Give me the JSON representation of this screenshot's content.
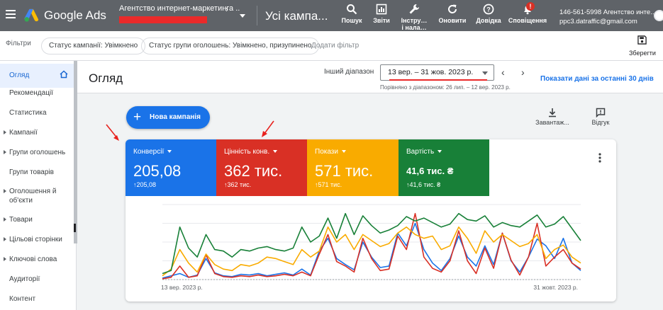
{
  "header": {
    "product": "Google Ads",
    "account_name": "Агентство интернет-маркетинга ...",
    "page_title": "Усі кампа...",
    "tools": [
      {
        "label": "Пошук"
      },
      {
        "label": "Звіти"
      },
      {
        "label": "Інстру…",
        "label2": "і нала…"
      },
      {
        "label": "Оновити"
      },
      {
        "label": "Довідка"
      },
      {
        "label": "Сповіщення",
        "badge": "!"
      }
    ],
    "account_id": "146-561-5998 Агентство инте...",
    "account_email": "ppc3.datraffic@gmail.com"
  },
  "filters": {
    "label": "Фільтри",
    "chips": [
      "Статус кампанії: Увімкнено",
      "Статус групи оголошень: Увімкнено, призупинено"
    ],
    "add_filter": "Додати фільтр",
    "save": "Зберегти"
  },
  "sidebar": {
    "items": [
      {
        "label": "Огляд"
      },
      {
        "label": "Рекомендації"
      },
      {
        "label": "Статистика"
      },
      {
        "label": "Кампанії"
      },
      {
        "label": "Групи оголошень"
      },
      {
        "label": "Групи товарів"
      },
      {
        "label": "Оголошення й",
        "label2": "об'єкти"
      },
      {
        "label": "Товари"
      },
      {
        "label": "Цільові сторінки"
      },
      {
        "label": "Ключові слова"
      },
      {
        "label": "Аудиторії"
      },
      {
        "label": "Контент"
      }
    ]
  },
  "main": {
    "title": "Огляд",
    "range_label": "Інший діапазон",
    "date_range": "13 вер. – 31 жов. 2023 р.",
    "compare_text": "Порівняно з діапазоном: 26 лип. – 12 вер. 2023 р.",
    "show_last_30": "Показати дані за останні 30 днів",
    "new_campaign": "Нова кампанія",
    "download": "Завантаж...",
    "feedback": "Відгук"
  },
  "metrics": [
    {
      "name": "Конверсії",
      "value": "205,08",
      "delta": "↑205,08",
      "color": "#1a73e8"
    },
    {
      "name": "Цінність конв.",
      "value": "362 тис.",
      "delta": "↑362 тис.",
      "color": "#d93025"
    },
    {
      "name": "Покази",
      "value": "571 тис.",
      "delta": "↑571 тис.",
      "color": "#f9ab00"
    },
    {
      "name": "Вартість",
      "value": "41,6 тис. ₴",
      "delta": "↑41,6 тис. ₴",
      "color": "#188038"
    }
  ],
  "chart_data": {
    "type": "line",
    "x_start": "13 вер. 2023 р.",
    "x_end": "31 жовт. 2023 р.",
    "x_count": 49,
    "ylim": [
      0,
      100
    ],
    "grid": true,
    "series": [
      {
        "name": "Конверсії",
        "color": "#1a73e8",
        "values": [
          2,
          5,
          8,
          3,
          6,
          28,
          9,
          5,
          4,
          7,
          6,
          8,
          5,
          7,
          9,
          6,
          14,
          6,
          38,
          55,
          28,
          20,
          13,
          50,
          30,
          16,
          18,
          62,
          45,
          75,
          40,
          22,
          12,
          28,
          58,
          30,
          18,
          45,
          20,
          62,
          25,
          10,
          30,
          54,
          45,
          28,
          55,
          22,
          12
        ]
      },
      {
        "name": "Цінність конв.",
        "color": "#d93025",
        "values": [
          1,
          3,
          18,
          3,
          5,
          33,
          8,
          4,
          3,
          5,
          4,
          6,
          4,
          5,
          7,
          5,
          10,
          5,
          34,
          60,
          24,
          18,
          10,
          55,
          28,
          12,
          14,
          58,
          40,
          88,
          30,
          15,
          10,
          25,
          65,
          25,
          8,
          42,
          15,
          62,
          26,
          6,
          30,
          75,
          18,
          30,
          40,
          22,
          14
        ]
      },
      {
        "name": "Покази",
        "color": "#f9ab00",
        "values": [
          5,
          14,
          40,
          22,
          10,
          34,
          20,
          14,
          12,
          20,
          18,
          22,
          30,
          28,
          24,
          20,
          40,
          30,
          38,
          70,
          50,
          60,
          40,
          60,
          52,
          44,
          48,
          62,
          70,
          60,
          55,
          58,
          40,
          45,
          70,
          55,
          35,
          65,
          50,
          60,
          52,
          44,
          48,
          60,
          28,
          40,
          46,
          30,
          22
        ]
      },
      {
        "name": "Вартість",
        "color": "#188038",
        "values": [
          8,
          12,
          70,
          42,
          30,
          60,
          40,
          38,
          30,
          40,
          38,
          42,
          44,
          40,
          38,
          42,
          70,
          50,
          58,
          82,
          55,
          88,
          60,
          85,
          72,
          62,
          66,
          72,
          84,
          78,
          82,
          76,
          70,
          74,
          88,
          80,
          78,
          85,
          70,
          76,
          72,
          70,
          78,
          86,
          70,
          74,
          84,
          68,
          52
        ]
      }
    ]
  }
}
